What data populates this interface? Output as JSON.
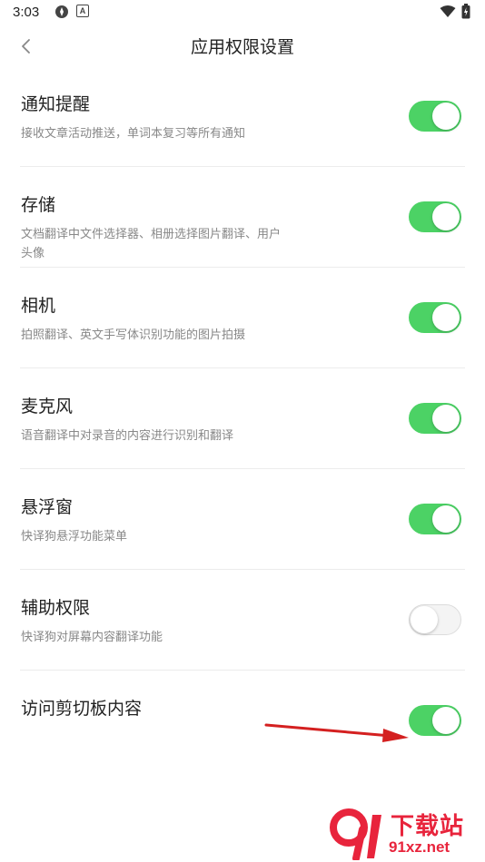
{
  "status_bar": {
    "time": "3:03",
    "icons": [
      "sync-icon",
      "a-badge-icon",
      "wifi-icon",
      "battery-icon"
    ]
  },
  "app_bar": {
    "title": "应用权限设置"
  },
  "permissions": [
    {
      "title": "通知提醒",
      "description": "接收文章活动推送，单词本复习等所有通知",
      "enabled": true
    },
    {
      "title": "存储",
      "description": "文档翻译中文件选择器、相册选择图片翻译、用户头像",
      "enabled": true
    },
    {
      "title": "相机",
      "description": "拍照翻译、英文手写体识别功能的图片拍摄",
      "enabled": true
    },
    {
      "title": "麦克风",
      "description": "语音翻译中对录音的内容进行识别和翻译",
      "enabled": true
    },
    {
      "title": "悬浮窗",
      "description": "快译狗悬浮功能菜单",
      "enabled": true
    },
    {
      "title": "辅助权限",
      "description": "快译狗对屏幕内容翻译功能",
      "enabled": false
    },
    {
      "title": "访问剪切板内容",
      "description": "",
      "enabled": true
    }
  ],
  "colors": {
    "toggle_on": "#4cd265",
    "arrow": "#d42020",
    "watermark": "#e8243c"
  },
  "watermark": {
    "main": "下载站",
    "sub": "91xz.net"
  }
}
